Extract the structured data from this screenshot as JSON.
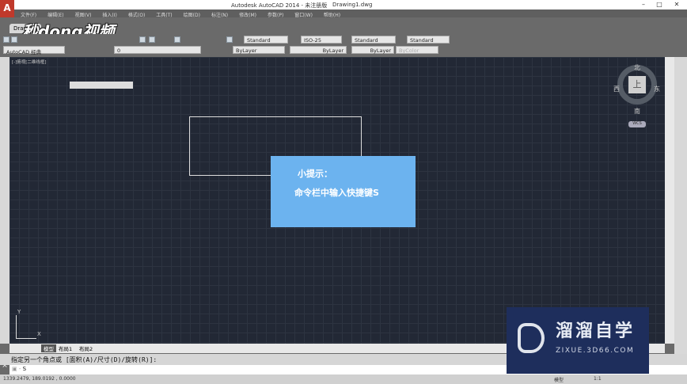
{
  "window": {
    "title": "Autodesk AutoCAD 2014 - 未注册版",
    "document": "Drawing1.dwg",
    "app_icon": "A"
  },
  "menu": [
    "文件(F)",
    "编辑(E)",
    "视图(V)",
    "插入(I)",
    "格式(O)",
    "工具(T)",
    "绘图(D)",
    "标注(N)",
    "修改(M)",
    "参数(P)",
    "窗口(W)",
    "帮助(H)"
  ],
  "file_tab": "Drawing1",
  "brand_watermark": "秒dong视频",
  "toolbar": {
    "text_style": "Standard",
    "dim_style": "ISO-25",
    "table_style": "Standard",
    "multileader_style": "Standard",
    "workspace": "AutoCAD 经典",
    "layer": "0",
    "color": "ByLayer",
    "linetype": "ByLayer",
    "lineweight": "ByLayer",
    "plot_style": "ByColor"
  },
  "viewport": {
    "label": "[-]俯视[二维线框]"
  },
  "viewcube": {
    "north": "北",
    "south": "南",
    "east": "东",
    "west": "西",
    "face": "上",
    "wcs": "WCS"
  },
  "ucs": {
    "x": "X",
    "y": "Y"
  },
  "tip": {
    "title": "小提示：",
    "body": "命令栏中输入快捷键S"
  },
  "layout_tabs": [
    "模型",
    "布局1",
    "布局2"
  ],
  "command": {
    "history": "指定另一个角点或 [面积(A)/尺寸(D)/旋转(R)]:",
    "input": "S"
  },
  "status": {
    "coords": "1339.2479, 189.0192 , 0.0000",
    "model": "模型",
    "scale": "1:1"
  },
  "watermark": {
    "name": "溜溜自学",
    "url": "ZIXUE.3D66.COM"
  }
}
